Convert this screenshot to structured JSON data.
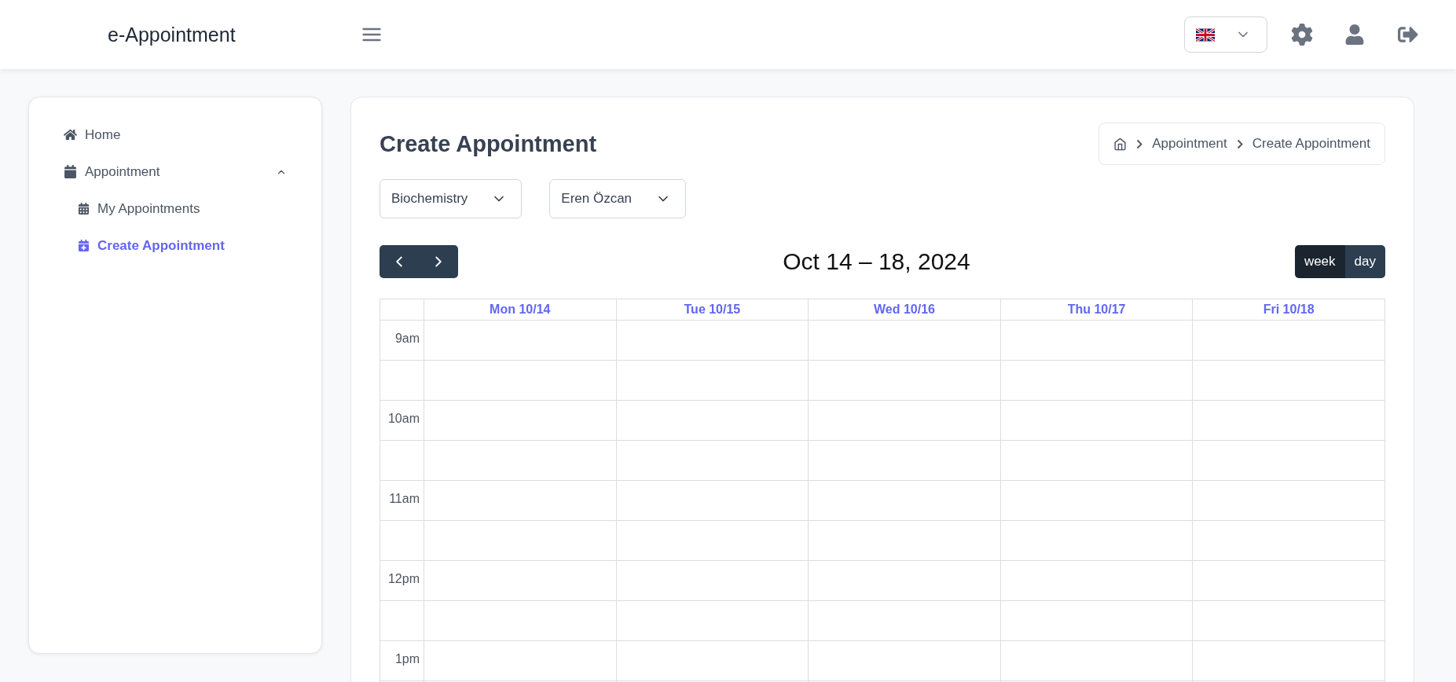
{
  "header": {
    "brand": "e-Appointment"
  },
  "sidebar": {
    "items": [
      {
        "label": "Home",
        "selected": false
      },
      {
        "label": "Appointment",
        "selected": false,
        "expanded": true,
        "children": [
          {
            "label": "My Appointments",
            "selected": false
          },
          {
            "label": "Create Appointment",
            "selected": true
          }
        ]
      }
    ]
  },
  "page": {
    "title": "Create Appointment",
    "breadcrumb": [
      "Appointment",
      "Create Appointment"
    ]
  },
  "filters": [
    {
      "value": "Biochemistry"
    },
    {
      "value": "Eren Özcan"
    }
  ],
  "calendar": {
    "title": "Oct 14 – 18, 2024",
    "views": [
      {
        "label": "week",
        "selected": true
      },
      {
        "label": "day",
        "selected": false
      }
    ],
    "days": [
      "Mon 10/14",
      "Tue 10/15",
      "Wed 10/16",
      "Thu 10/17",
      "Fri 10/18"
    ],
    "times": [
      "9am",
      "10am",
      "11am",
      "12pm",
      "1pm"
    ]
  }
}
